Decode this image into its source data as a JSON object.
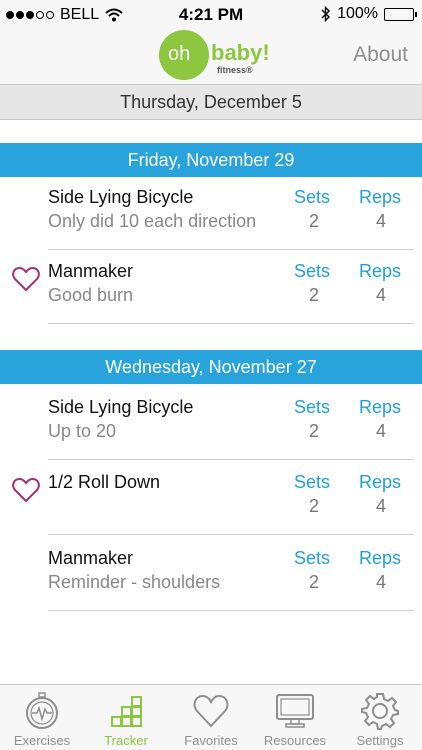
{
  "status_bar": {
    "carrier": "BELL",
    "time": "4:21 PM",
    "battery": "100%",
    "signal_bars_filled": 3,
    "signal_bars_total": 5
  },
  "nav": {
    "logo_oh": "oh",
    "logo_baby": "baby!",
    "logo_fitness": "fitness®",
    "about_label": "About"
  },
  "current_date": "Thursday, December 5",
  "days": [
    {
      "label": "Friday, November 29",
      "entries": [
        {
          "title": "Side Lying Bicycle",
          "note": "Only did 10 each direction",
          "sets_label": "Sets",
          "sets": "2",
          "reps_label": "Reps",
          "reps": "4",
          "favorite": false
        },
        {
          "title": "Manmaker",
          "note": "Good burn",
          "sets_label": "Sets",
          "sets": "2",
          "reps_label": "Reps",
          "reps": "4",
          "favorite": true
        }
      ]
    },
    {
      "label": "Wednesday, November 27",
      "entries": [
        {
          "title": "Side Lying Bicycle",
          "note": "Up to 20",
          "sets_label": "Sets",
          "sets": "2",
          "reps_label": "Reps",
          "reps": "4",
          "favorite": false
        },
        {
          "title": "1/2 Roll Down",
          "note": "",
          "sets_label": "Sets",
          "sets": "2",
          "reps_label": "Reps",
          "reps": "4",
          "favorite": true
        },
        {
          "title": "Manmaker",
          "note": "Reminder - shoulders",
          "sets_label": "Sets",
          "sets": "2",
          "reps_label": "Reps",
          "reps": "4",
          "favorite": false
        }
      ]
    }
  ],
  "tabs": [
    {
      "label": "Exercises",
      "icon": "stopwatch-icon",
      "active": false
    },
    {
      "label": "Tracker",
      "icon": "blocks-icon",
      "active": true
    },
    {
      "label": "Favorites",
      "icon": "heart-icon",
      "active": false
    },
    {
      "label": "Resources",
      "icon": "monitor-icon",
      "active": false
    },
    {
      "label": "Settings",
      "icon": "gear-icon",
      "active": false
    }
  ],
  "colors": {
    "accent_blue": "#29a3dc",
    "brand_green": "#8dc63f",
    "favorite_heart": "#a3306f"
  }
}
